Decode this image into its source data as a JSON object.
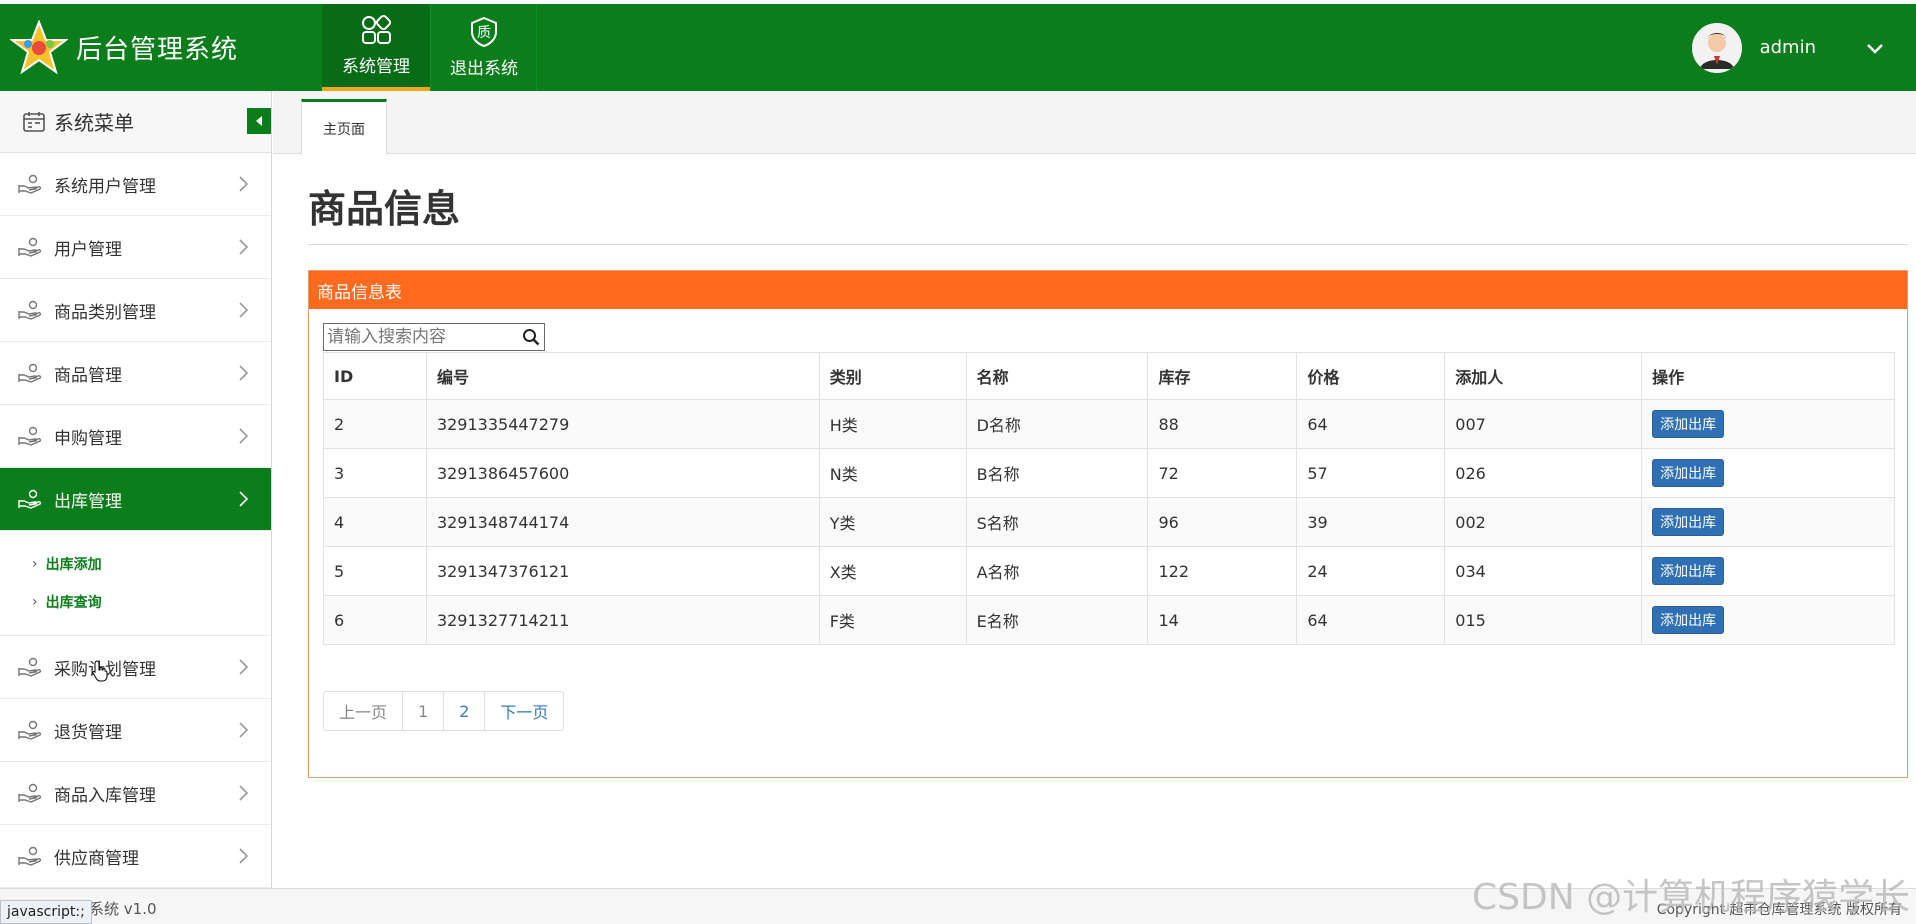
{
  "header": {
    "app_title": "后台管理系统",
    "nav": [
      {
        "label": "系统管理",
        "icon": "grid-icon",
        "active": true
      },
      {
        "label": "退出系统",
        "icon": "shield-quality-icon",
        "glyph": "质",
        "active": false
      }
    ],
    "user": {
      "name": "admin"
    }
  },
  "sidebar": {
    "title": "系统菜单",
    "items": [
      {
        "label": "系统用户管理"
      },
      {
        "label": "用户管理"
      },
      {
        "label": "商品类别管理"
      },
      {
        "label": "商品管理"
      },
      {
        "label": "申购管理"
      },
      {
        "label": "出库管理",
        "active": true
      },
      {
        "label": "采购计划管理"
      },
      {
        "label": "退货管理"
      },
      {
        "label": "商品入库管理"
      },
      {
        "label": "供应商管理"
      }
    ],
    "sub_items": [
      {
        "label": "出库添加"
      },
      {
        "label": "出库查询"
      }
    ]
  },
  "tabs": [
    {
      "label": "主页面"
    }
  ],
  "main": {
    "page_title": "商品信息",
    "panel_title": "商品信息表",
    "search_placeholder": "请输入搜索内容",
    "table": {
      "headers": [
        "ID",
        "编号",
        "类别",
        "名称",
        "库存",
        "价格",
        "添加人",
        "操作"
      ],
      "rows": [
        {
          "id": "2",
          "code": "3291335447279",
          "category": "H类",
          "name": "D名称",
          "stock": "88",
          "price": "64",
          "added_by": "007",
          "action": "添加出库"
        },
        {
          "id": "3",
          "code": "3291386457600",
          "category": "N类",
          "name": "B名称",
          "stock": "72",
          "price": "57",
          "added_by": "026",
          "action": "添加出库"
        },
        {
          "id": "4",
          "code": "3291348744174",
          "category": "Y类",
          "name": "S名称",
          "stock": "96",
          "price": "39",
          "added_by": "002",
          "action": "添加出库"
        },
        {
          "id": "5",
          "code": "3291347376121",
          "category": "X类",
          "name": "A名称",
          "stock": "122",
          "price": "24",
          "added_by": "034",
          "action": "添加出库"
        },
        {
          "id": "6",
          "code": "3291327714211",
          "category": "F类",
          "name": "E名称",
          "stock": "14",
          "price": "64",
          "added_by": "015",
          "action": "添加出库"
        }
      ]
    },
    "pagination": {
      "prev": "上一页",
      "pages": [
        "1",
        "2"
      ],
      "next": "下一页"
    }
  },
  "footer": {
    "version": "理系统 v1.0",
    "copyright": "Copyright  超市仓库管理系统 版权所有",
    "status_link": "javascript:;",
    "watermark": "CSDN @计算机程序猿学长"
  },
  "colors": {
    "brand_green": "#0b7d1b",
    "panel_orange": "#ff6a1f",
    "button_blue": "#2f6fb4",
    "accent_yellow": "#f0a81a"
  }
}
